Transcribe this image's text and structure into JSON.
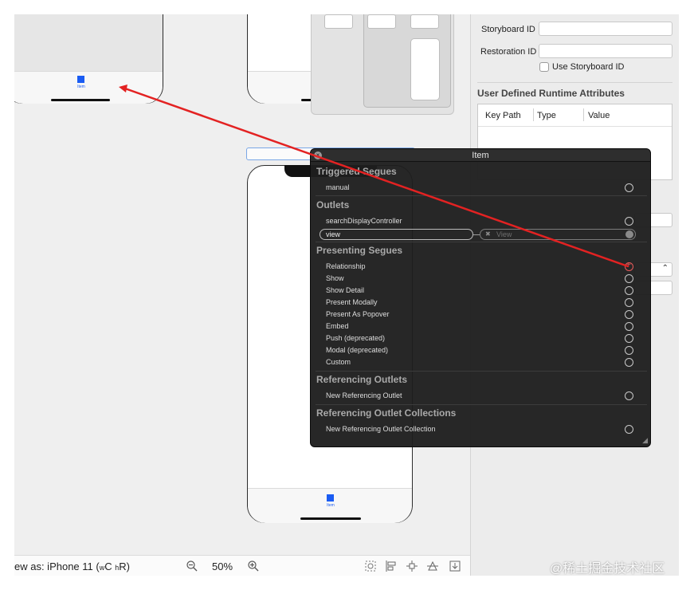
{
  "scenes": {
    "left_tab_label": "Item",
    "bottom_tab_label": "Item"
  },
  "bottom_bar": {
    "view_as_prefix": "ew as: iPhone 11 (",
    "w": "w",
    "C": "C",
    "h": "h",
    "R": "R",
    "view_as_suffix": ")",
    "zoom": "50%"
  },
  "inspector": {
    "storyboard_id_label": "Storyboard ID",
    "restoration_id_label": "Restoration ID",
    "use_storyboard_id_label": "Use Storyboard ID",
    "udra_title": "User Defined Runtime Attributes",
    "col_key_path": "Key Path",
    "col_type": "Type",
    "col_value": "Value"
  },
  "hud": {
    "title": "Item",
    "sections": {
      "triggered": "Triggered Segues",
      "outlets": "Outlets",
      "presenting": "Presenting Segues",
      "referencing": "Referencing Outlets",
      "collections": "Referencing Outlet Collections"
    },
    "triggered_items": [
      "manual"
    ],
    "outlet_items": [
      "searchDisplayController",
      "view"
    ],
    "outlet_target": "View",
    "presenting_items": [
      "Relationship",
      "Show",
      "Show Detail",
      "Present Modally",
      "Present As Popover",
      "Embed",
      "Push (deprecated)",
      "Modal (deprecated)",
      "Custom"
    ],
    "referencing_items": [
      "New Referencing Outlet"
    ],
    "collection_items": [
      "New Referencing Outlet Collection"
    ]
  },
  "connection_color": "#e32222",
  "accent": "#1a5cf3",
  "watermark": "@稀土掘金技术社区"
}
